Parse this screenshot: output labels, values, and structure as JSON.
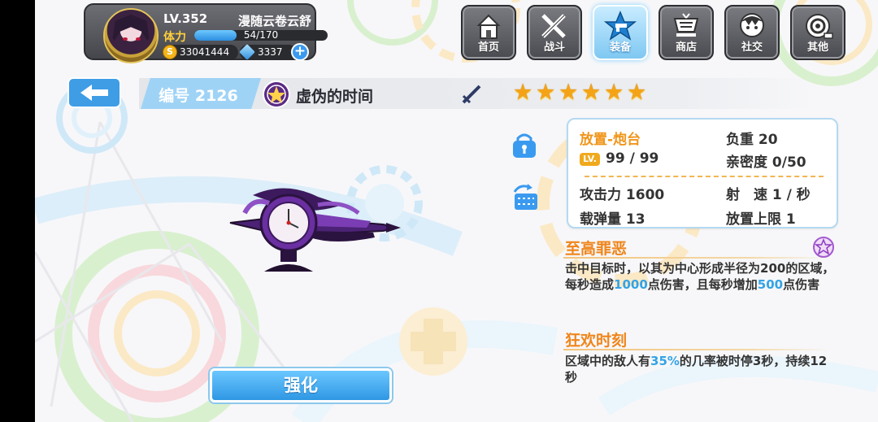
{
  "player": {
    "level": "LV.352",
    "name": "漫随云卷云舒",
    "stamina_label": "体力",
    "stamina_text": "54/170",
    "stamina_fraction": 0.318,
    "gold": "33041444",
    "gold_symbol": "S",
    "gems": "3337",
    "add_symbol": "+"
  },
  "nav": [
    {
      "label": "首页",
      "icon": "house-icon",
      "active": false
    },
    {
      "label": "战斗",
      "icon": "crossed-swords-icon",
      "active": false
    },
    {
      "label": "装备",
      "icon": "star-gun-icon",
      "active": true
    },
    {
      "label": "商店",
      "icon": "shop-icon",
      "active": false
    },
    {
      "label": "社交",
      "icon": "character-icon",
      "active": false
    },
    {
      "label": "其他",
      "icon": "target-icon",
      "active": false
    }
  ],
  "weapon": {
    "serial": "编号 2126",
    "name": "虚伪的时间",
    "stars": 6,
    "star_glyph": "★"
  },
  "stats": {
    "type": "放置-炮台",
    "weight": "负重 20",
    "lv_badge": "LV.",
    "level": "99 / 99",
    "affinity": "亲密度 0/50",
    "attack": "攻击力 1600",
    "speed": "射　速 1 / 秒",
    "ammo": "载弹量 13",
    "place_limit": "放置上限 1"
  },
  "skills": [
    {
      "title": "至高罪恶",
      "desc_parts": [
        "击中目标时，以其为中心形成半径为200的区域，每秒造成",
        "1000",
        "点伤害，且每秒增加",
        "500",
        "点伤害"
      ]
    },
    {
      "title": "狂欢时刻",
      "desc_parts": [
        "区域中的敌人有",
        "35%",
        "的几率被时停3秒，持续12秒"
      ]
    }
  ],
  "upgrade_label": "强化",
  "colors": {
    "accent_blue": "#33a3e6",
    "skill_orange": "#f0851a",
    "star_gold": "#f5a316"
  }
}
